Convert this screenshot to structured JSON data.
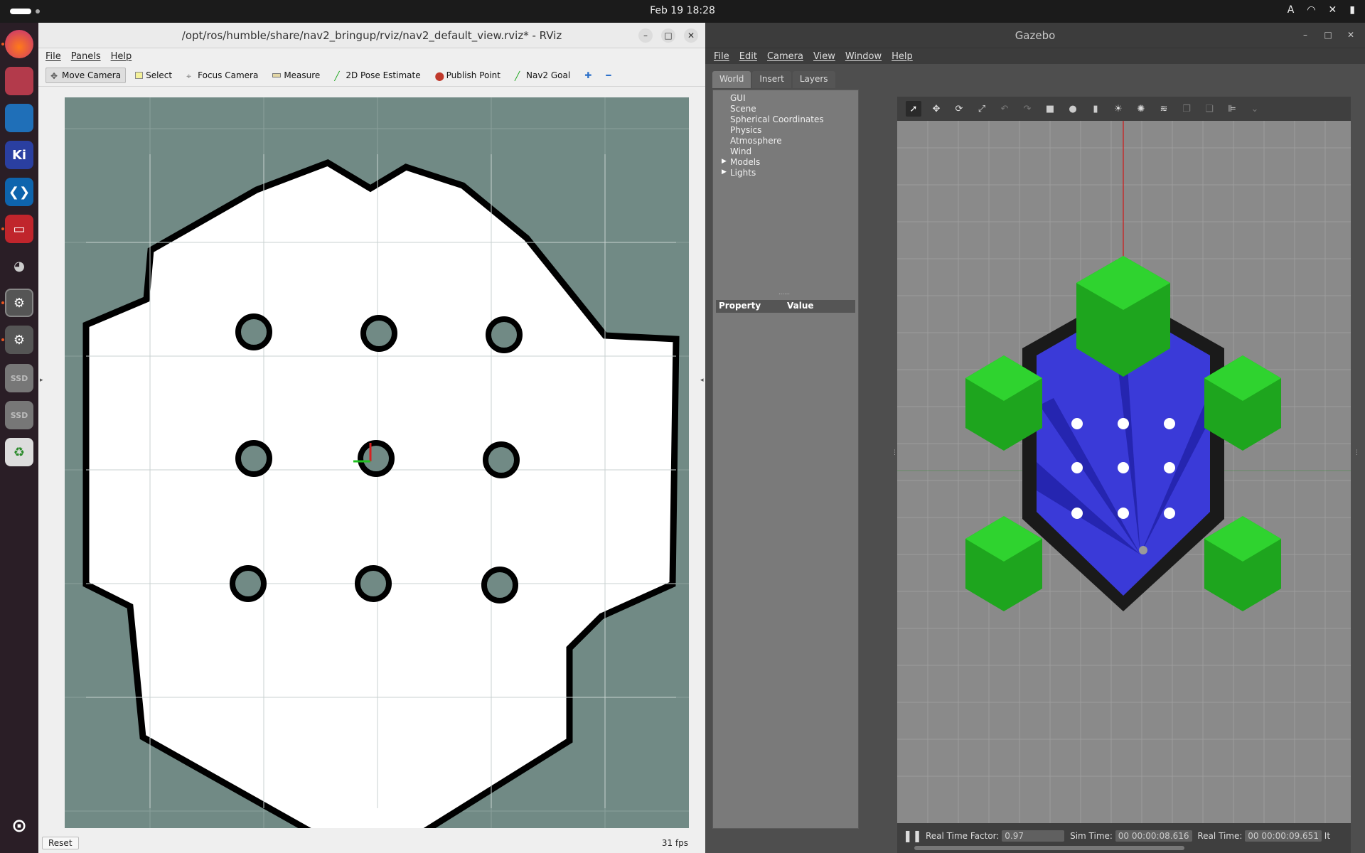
{
  "topbar": {
    "datetime": "Feb 19  18:28",
    "keyboard": "A"
  },
  "dock": {
    "items": [
      "firefox-icon",
      "files-icon",
      "writer-icon",
      "kicad-icon",
      "vscode-icon",
      "terminal-icon",
      "gimp-icon",
      "settings-icon",
      "settings-icon",
      "ssd-icon",
      "ssd-icon",
      "trash-icon"
    ],
    "ssd_label": "SSD",
    "kicad_label": "Ki"
  },
  "rviz": {
    "title": "/opt/ros/humble/share/nav2_bringup/rviz/nav2_default_view.rviz* - RViz",
    "menu": [
      "File",
      "Panels",
      "Help"
    ],
    "tools": {
      "move_camera": "Move Camera",
      "select": "Select",
      "focus_camera": "Focus Camera",
      "measure": "Measure",
      "pose_estimate": "2D Pose Estimate",
      "publish_point": "Publish Point",
      "nav2_goal": "Nav2 Goal"
    },
    "reset_label": "Reset",
    "fps": "31 fps",
    "colors": {
      "map_bg": "#718a85",
      "free": "#ffffff",
      "wall": "#000000"
    }
  },
  "gazebo": {
    "title": "Gazebo",
    "menu": [
      "File",
      "Edit",
      "Camera",
      "View",
      "Window",
      "Help"
    ],
    "tabs": [
      "World",
      "Insert",
      "Layers"
    ],
    "tree": [
      "GUI",
      "Scene",
      "Spherical Coordinates",
      "Physics",
      "Atmosphere",
      "Wind",
      "Models",
      "Lights"
    ],
    "property_header": "Property",
    "value_header": "Value",
    "status": {
      "rtf_label": "Real Time Factor:",
      "rtf_value": "0.97",
      "sim_label": "Sim Time:",
      "sim_value": "00 00:00:08.616",
      "real_label": "Real Time:",
      "real_value": "00 00:00:09.651",
      "iter_label": "It"
    },
    "colors": {
      "ground": "#8a8a8a",
      "green": "#1ea51e",
      "laser": "#3535d8"
    }
  }
}
